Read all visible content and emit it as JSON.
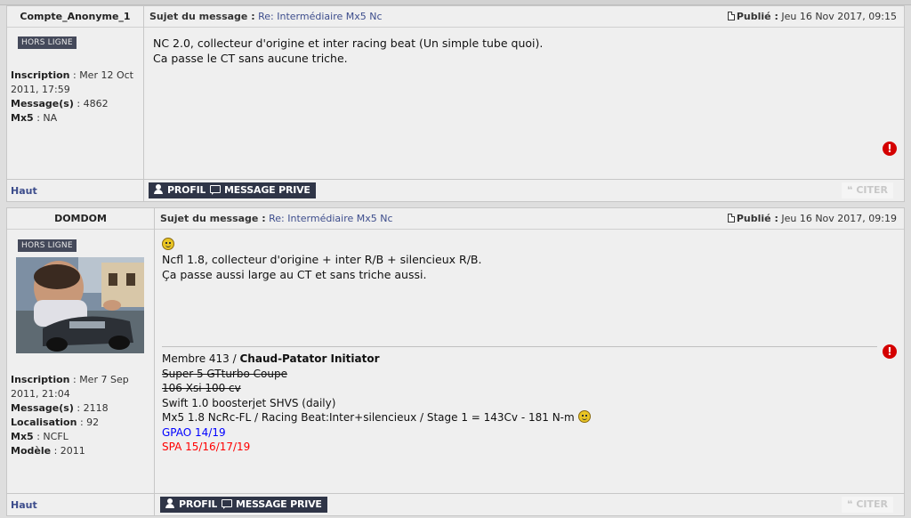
{
  "posts": [
    {
      "username": "Compte_Anonyme_1",
      "subject_label": "Sujet du message :",
      "subject_link": "Re: Intermédiaire Mx5 Nc",
      "published_label": "Publié :",
      "published_date": "Jeu 16 Nov 2017, 09:15",
      "status": "HORS LIGNE",
      "profile": [
        {
          "label": "Inscription",
          "value": "Mer 12 Oct 2011, 17:59"
        },
        {
          "label": "Message(s)",
          "value": "4862"
        },
        {
          "label": "Mx5",
          "value": "NA"
        }
      ],
      "message_lines": [
        "NC 2.0, collecteur d'origine et inter racing beat (Un simple tube quoi).",
        "Ca passe le CT sans aucune triche."
      ],
      "footer": {
        "top_link": "Haut",
        "profile_button": "PROFIL",
        "pm_button": "MESSAGE PRIVE",
        "quote_button": "CITER"
      }
    },
    {
      "username": "DOMDOM",
      "subject_label": "Sujet du message :",
      "subject_link": "Re: Intermédiaire Mx5 Nc",
      "published_label": "Publié :",
      "published_date": "Jeu 16 Nov 2017, 09:19",
      "status": "HORS LIGNE",
      "profile": [
        {
          "label": "Inscription",
          "value": "Mer 7 Sep 2011, 21:04"
        },
        {
          "label": "Message(s)",
          "value": "2118"
        },
        {
          "label": "Localisation",
          "value": "92"
        },
        {
          "label": "Mx5",
          "value": "NCFL"
        },
        {
          "label": "Modèle",
          "value": "2011"
        }
      ],
      "message_lines": [
        "Ncfl 1.8, collecteur d'origine + inter R/B + silencieux R/B.",
        "Ça passe aussi large au CT et sans triche aussi."
      ],
      "signature": {
        "line1_prefix": "Membre 413 / ",
        "line1_bold": "Chaud-Patator Initiator",
        "line2": "Super 5 GTturbo Coupe",
        "line3": "106 Xsi 100 cv",
        "line4": "Swift 1.0 boosterjet SHVS (daily)",
        "line5": "Mx5 1.8 NcRc-FL / Racing Beat:Inter+silencieux / Stage 1 = 143Cv - 181 N-m",
        "line6": "GPAO 14/19",
        "line7": "SPA 15/16/17/19"
      },
      "footer": {
        "top_link": "Haut",
        "profile_button": "PROFIL",
        "pm_button": "MESSAGE PRIVE",
        "quote_button": "CITER"
      }
    }
  ],
  "colors": {
    "link": "#3d4d8c",
    "button_bg": "#2f3547",
    "warn": "#d40000",
    "sig_blue": "#0000ff",
    "sig_red": "#ff0000"
  }
}
